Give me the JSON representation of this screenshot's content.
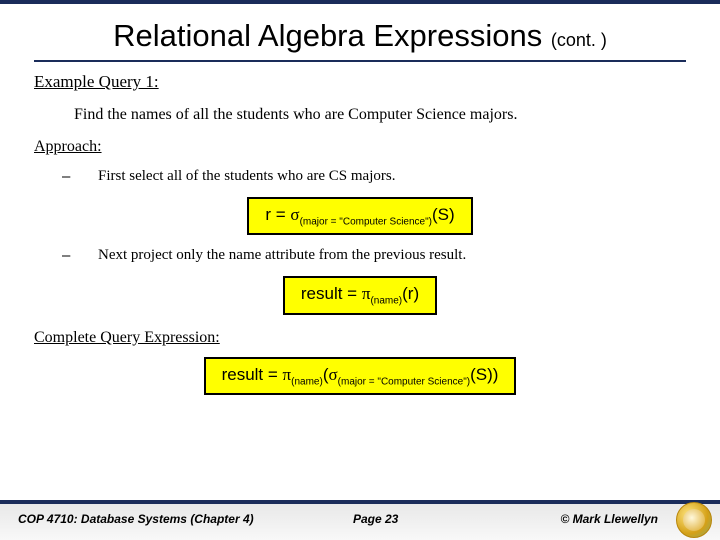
{
  "title": {
    "main": "Relational Algebra Expressions",
    "cont": "(cont. )"
  },
  "example_label": "Example Query 1:",
  "query_text": "Find the names of all the students who are Computer Science majors.",
  "approach_label": "Approach:",
  "steps": [
    {
      "dash": "–",
      "text": "First select all of the students who are CS majors."
    },
    {
      "dash": "–",
      "text": "Next project only the name attribute from the previous result."
    }
  ],
  "formula1": {
    "lhs": "r = ",
    "op": "σ",
    "sub": "(major = \"Computer Science\")",
    "arg": "(S)"
  },
  "formula2": {
    "lhs": "result = ",
    "op": "π",
    "sub": "(name)",
    "arg": "(r)"
  },
  "complete_label": "Complete Query Expression:",
  "formula3": {
    "lhs": "result = ",
    "op1": "π",
    "sub1": "(name)",
    "open": "(",
    "op2": "σ",
    "sub2": "(major = \"Computer Science\")",
    "arg": "(S))"
  },
  "footer": {
    "left": "COP 4710: Database Systems  (Chapter 4)",
    "mid": "Page 23",
    "right": "© Mark Llewellyn"
  }
}
